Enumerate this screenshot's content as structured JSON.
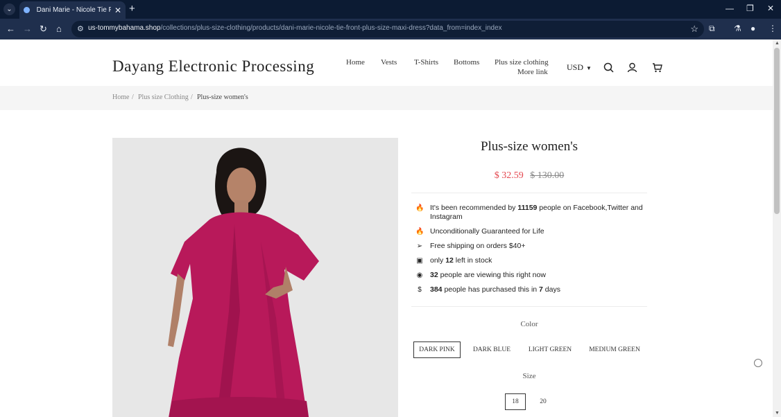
{
  "browser": {
    "tab_title": "Dani Marie - Nicole Tie Front P",
    "url_host": "us-tommybahama.shop",
    "url_path": "/collections/plus-size-clothing/products/dani-marie-nicole-tie-front-plus-size-maxi-dress?data_from=index_index"
  },
  "header": {
    "logo": "Dayang Electronic Processing",
    "nav": [
      "Home",
      "Vests",
      "T-Shirts",
      "Bottoms",
      "Plus size clothing",
      "More link"
    ],
    "currency": "USD"
  },
  "breadcrumb": {
    "items": [
      "Home",
      "Plus size Clothing",
      "Plus-size women's"
    ],
    "separator": "/"
  },
  "product": {
    "title": "Plus-size women's",
    "price": "$ 32.59",
    "compare_price": "$ 130.00",
    "features": [
      {
        "icon": "fire-icon",
        "pre": "It's been recommended by ",
        "bold": "11159",
        "post": " people on Facebook,Twitter and Instagram"
      },
      {
        "icon": "fire-icon",
        "pre": "Unconditionally Guaranteed for Life",
        "bold": "",
        "post": ""
      },
      {
        "icon": "shipping-icon",
        "pre": "Free shipping on orders $40+",
        "bold": "",
        "post": ""
      },
      {
        "icon": "box-icon",
        "pre": "only ",
        "bold": "12",
        "post": " left in stock"
      },
      {
        "icon": "eye-icon",
        "pre": "",
        "bold": "32",
        "post": " people are viewing this right now"
      },
      {
        "icon": "dollar-icon",
        "pre": "",
        "bold": "384",
        "post": " people has purchased this in ",
        "bold2": "7",
        "post2": " days"
      }
    ],
    "color_label": "Color",
    "colors": [
      "DARK PINK",
      "DARK BLUE",
      "LIGHT GREEN",
      "MEDIUM GREEN"
    ],
    "selected_color": "DARK PINK",
    "size_label": "Size",
    "sizes": [
      "18",
      "20"
    ],
    "selected_size": "18"
  },
  "colors": {
    "accent_price": "#e4474f",
    "dress": "#b8195a",
    "chrome_dark": "#0c1b33"
  }
}
